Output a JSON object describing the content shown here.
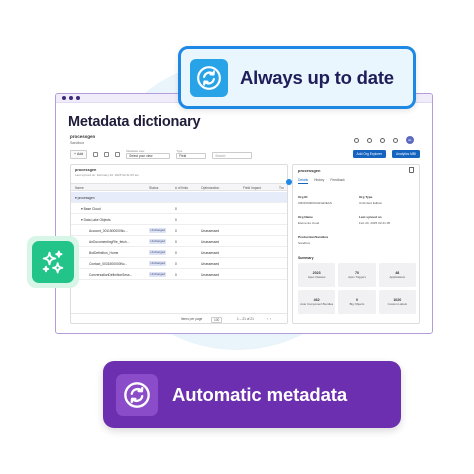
{
  "page_title": "Metadata dictionary",
  "org": {
    "name": "processgen",
    "env": "Sandbox",
    "avatar": "AL"
  },
  "toolbar": {
    "add_label": "Add",
    "metadata_view_label": "Metadata view",
    "metadata_view_value": "Select your view",
    "type_label": "Type",
    "type_value": "Field",
    "search_placeholder": "Search",
    "org_explorer_label": "Add Org Explorer",
    "analytics_label": "Analytics MBI"
  },
  "table": {
    "title": "processgen",
    "subtitle": "Last synced on: February 20, 2025 02:41:05 am",
    "columns": [
      "Name",
      "Status",
      "# of links",
      "Optimization",
      "Field Impact",
      "Tro"
    ],
    "rows": [
      {
        "name": "▾ processgen",
        "status": "",
        "links": "",
        "optimization": "",
        "selected": true,
        "indent": 0
      },
      {
        "name": "▾ Base Cloud",
        "status": "",
        "links": "0",
        "optimization": "",
        "selected": false,
        "indent": 1
      },
      {
        "name": "▾ Data Lake Objects",
        "status": "",
        "links": "0",
        "optimization": "",
        "selected": false,
        "indent": 1
      },
      {
        "name": "Account_0011500000Nc...",
        "status": "Unchanged",
        "links": "0",
        "optimization": "Unassessed",
        "selected": false,
        "indent": 2
      },
      {
        "name": "AnDocumentingFile_fetch...",
        "status": "Unchanged",
        "links": "0",
        "optimization": "Unassessed",
        "selected": false,
        "indent": 2
      },
      {
        "name": "BotDefinition_Home",
        "status": "Unchanged",
        "links": "0",
        "optimization": "Unassessed",
        "selected": false,
        "indent": 2
      },
      {
        "name": "Contact_0031500000Nc...",
        "status": "Unchanged",
        "links": "0",
        "optimization": "Unassessed",
        "selected": false,
        "indent": 2
      },
      {
        "name": "ConversationDefinitionSess...",
        "status": "Unchanged",
        "links": "0",
        "optimization": "Unassessed",
        "selected": false,
        "indent": 2
      }
    ],
    "pager": {
      "items_per_page_label": "Items per page",
      "items_per_page": "100",
      "range": "1 – 21 of 21"
    }
  },
  "detail": {
    "title": "processgen",
    "tabs": [
      "Details",
      "History",
      "Feedback"
    ],
    "fields": [
      {
        "k": "Org ID",
        "v": "00D1500000AbNaDEAS"
      },
      {
        "k": "Org Type",
        "v": "Unlimited Edition"
      },
      {
        "k": "Org Name",
        "v": "Elements cloud"
      },
      {
        "k": "Last synced on",
        "v": "Feb 20, 2025 02:41:05"
      },
      {
        "k": "Production/Sandbox",
        "v": "Sandbox"
      }
    ],
    "summary_label": "Summary",
    "tiles": [
      {
        "num": "2023",
        "lbl": "Apex Classes"
      },
      {
        "num": "70",
        "lbl": "Apex Triggers"
      },
      {
        "num": "48",
        "lbl": "Applications"
      },
      {
        "num": "462",
        "lbl": "Auto Component Bundles"
      },
      {
        "num": "0",
        "lbl": "Big Objects"
      },
      {
        "num": "1020",
        "lbl": "Custom Labels"
      }
    ]
  },
  "badges": {
    "top": "Always up to date",
    "bottom": "Automatic metadata"
  },
  "icons": {
    "top_badge": "sync-icon",
    "bottom_badge": "sync-icon",
    "side": "sparkles-icon"
  },
  "colors": {
    "top_badge_border": "#1e88e5",
    "top_badge_bg": "#e9f6fd",
    "bottom_badge_bg": "#6b2fb0",
    "sparkle_green": "#22c489",
    "window_border": "#b39ddb",
    "primary_button": "#1565c0"
  }
}
